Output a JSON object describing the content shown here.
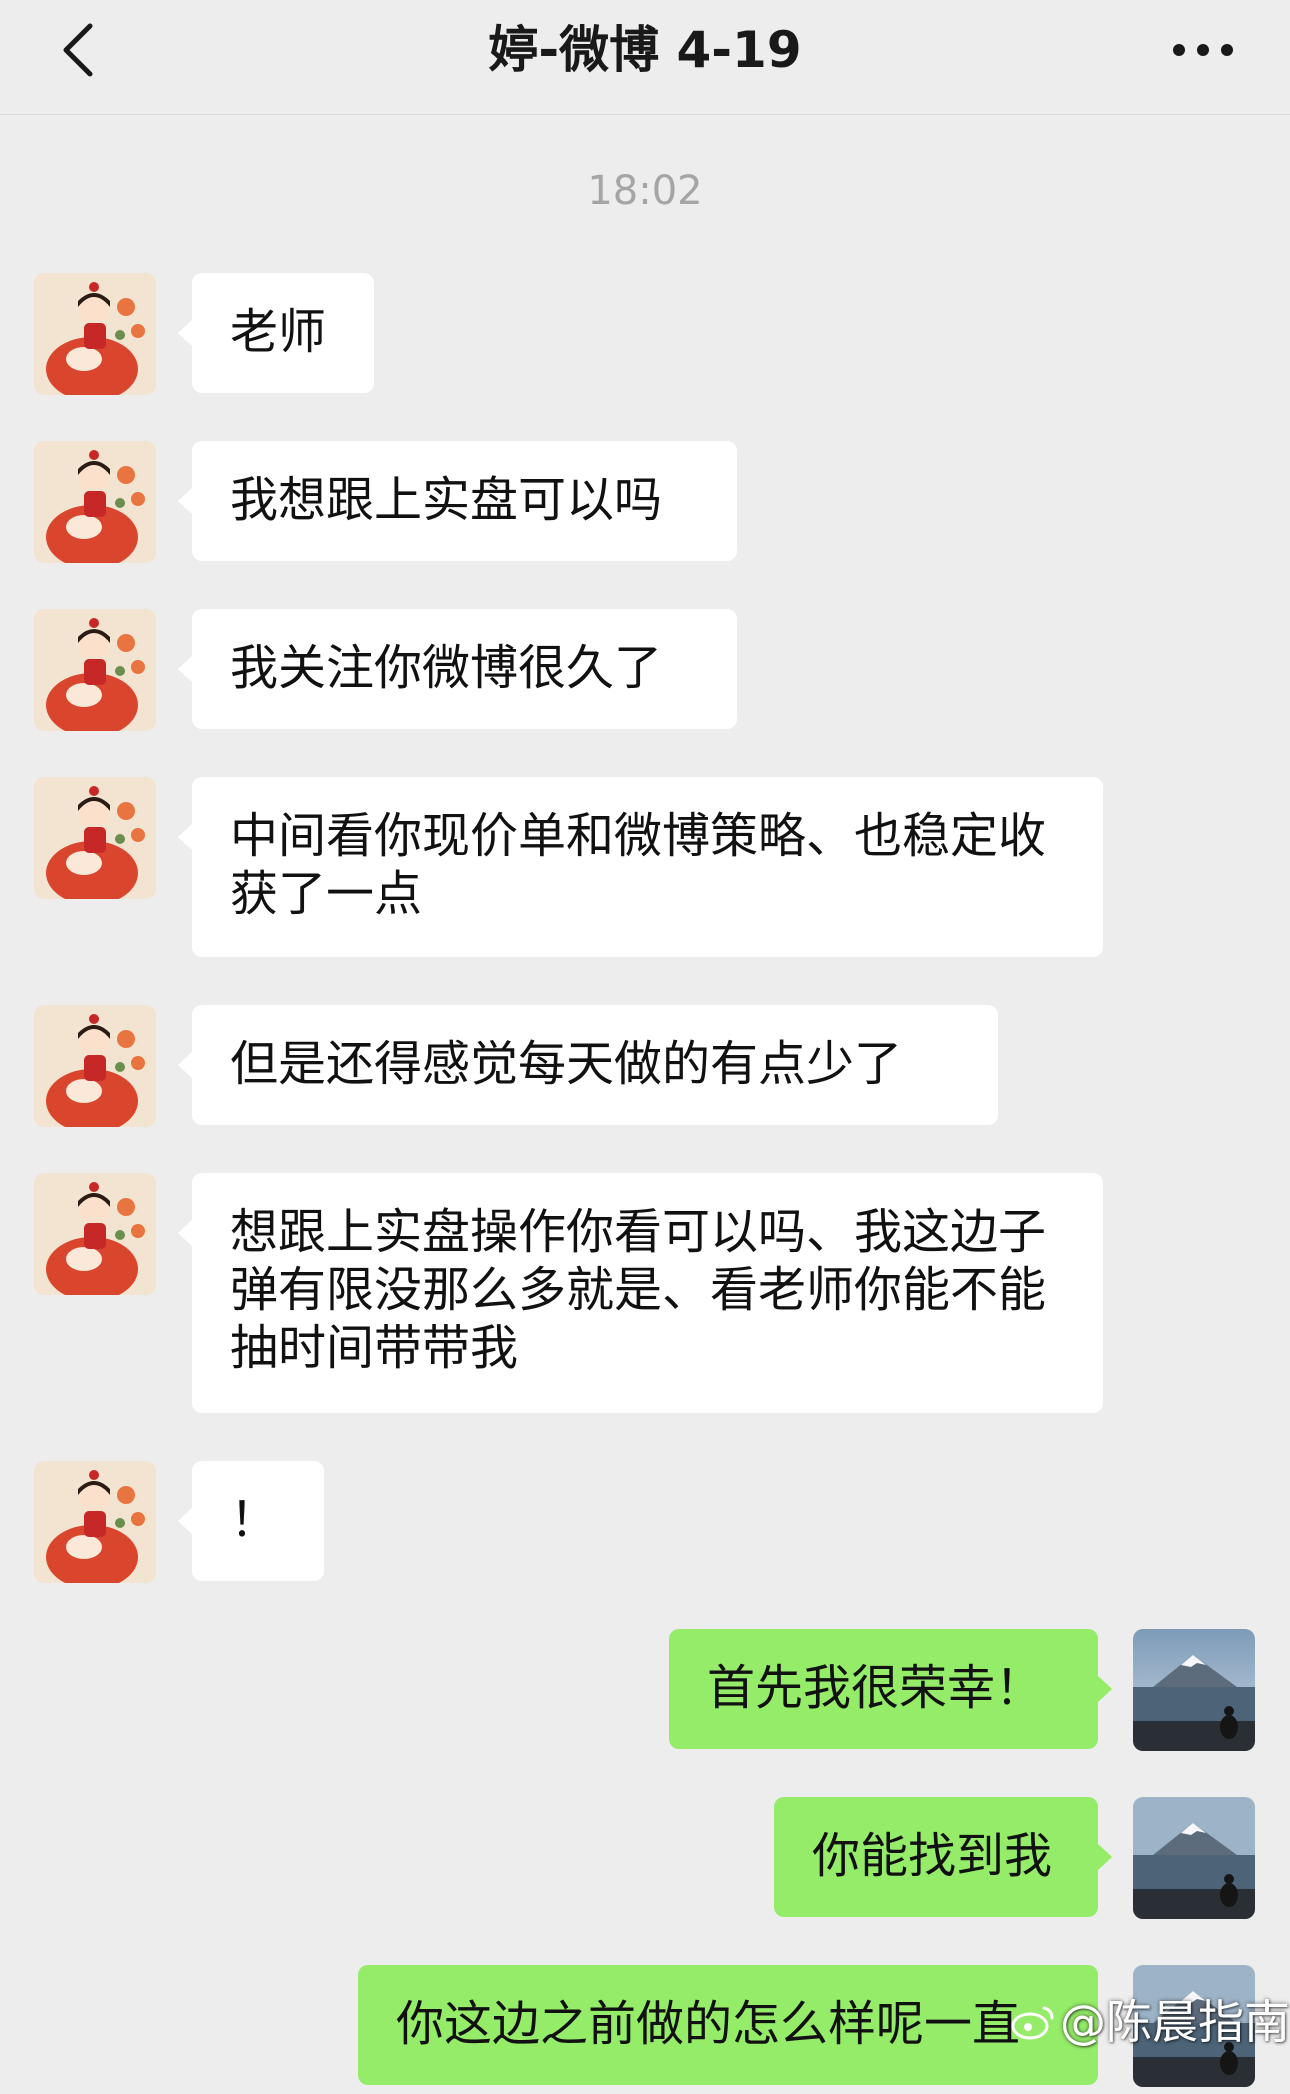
{
  "header": {
    "title": "婷-微博 4-19",
    "back_icon": "chevron-left-icon",
    "more_icon": "more-dots-icon"
  },
  "timestamp": "18:02",
  "messages": [
    {
      "side": "left",
      "text": "老师"
    },
    {
      "side": "left",
      "text": "我想跟上实盘可以吗"
    },
    {
      "side": "left",
      "text": "我关注你微博很久了"
    },
    {
      "side": "left",
      "text": "中间看你现价单和微博策略、也稳定收获了一点"
    },
    {
      "side": "left",
      "text": "但是还得感觉每天做的有点少了"
    },
    {
      "side": "left",
      "text": "想跟上实盘操作你看可以吗、我这边子弹有限没那么多就是、看老师你能不能抽时间带带我"
    },
    {
      "side": "left",
      "text": "！"
    },
    {
      "side": "right",
      "text": "首先我很荣幸！"
    },
    {
      "side": "right",
      "text": "你能找到我"
    },
    {
      "side": "right",
      "text": "你这边之前做的怎么样呢一直"
    }
  ],
  "watermark": {
    "text": "@陈晨指南",
    "icon": "weibo-logo-icon"
  },
  "colors": {
    "background": "#ededed",
    "bubble_incoming": "#ffffff",
    "bubble_outgoing": "#95ec69",
    "timestamp": "#a5a5a5"
  }
}
